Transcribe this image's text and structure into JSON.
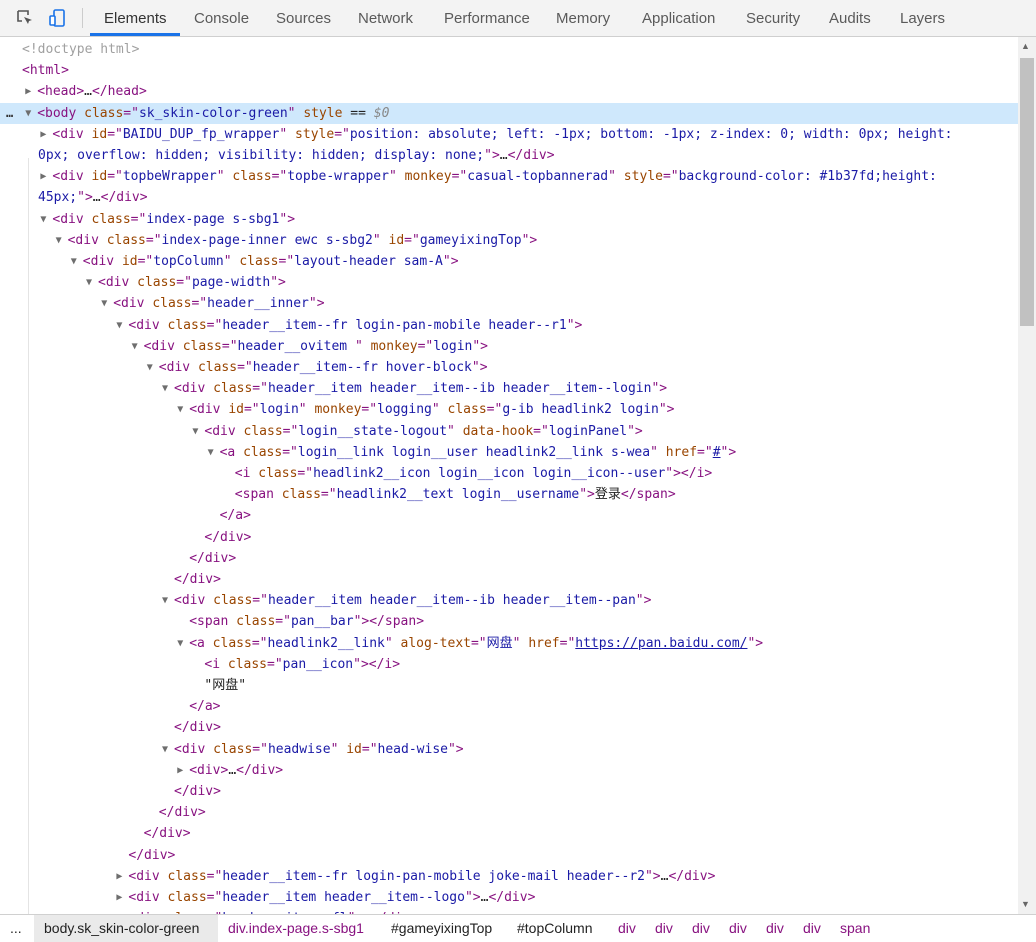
{
  "tabs": [
    {
      "label": "Elements",
      "active": true
    },
    {
      "label": "Console"
    },
    {
      "label": "Sources"
    },
    {
      "label": "Network"
    },
    {
      "label": "Performance"
    },
    {
      "label": "Memory"
    },
    {
      "label": "Application"
    },
    {
      "label": "Security"
    },
    {
      "label": "Audits"
    },
    {
      "label": "Layers"
    }
  ],
  "dom_lines": [
    {
      "indent": 0,
      "segs": [
        [
          "c",
          "<!doctype html>"
        ]
      ]
    },
    {
      "indent": 0,
      "segs": [
        [
          "t",
          "<html>"
        ]
      ]
    },
    {
      "indent": 1,
      "tri": "r",
      "segs": [
        [
          "t",
          "<head>"
        ],
        [
          "x",
          "…"
        ],
        [
          "t",
          "</head>"
        ]
      ]
    },
    {
      "indent": 1,
      "tri": "d",
      "sel": true,
      "segs": [
        [
          "t",
          "<body "
        ],
        [
          "a",
          "class"
        ],
        [
          "t",
          "=\""
        ],
        [
          "v",
          "sk_skin-color-green"
        ],
        [
          "t",
          "\" "
        ],
        [
          "a",
          "style"
        ],
        [
          "x",
          " == "
        ],
        [
          "g",
          "$0"
        ]
      ]
    },
    {
      "indent": 2,
      "tri": "r",
      "segs": [
        [
          "t",
          "<div "
        ],
        [
          "a",
          "id"
        ],
        [
          "t",
          "=\""
        ],
        [
          "v",
          "BAIDU_DUP_fp_wrapper"
        ],
        [
          "t",
          "\" "
        ],
        [
          "a",
          "style"
        ],
        [
          "t",
          "=\""
        ],
        [
          "v",
          "position: absolute; left: -1px; bottom: -1px; z-index: 0; width: 0px; height:"
        ]
      ]
    },
    {
      "indent": 2,
      "cont": true,
      "segs": [
        [
          "v",
          "0px; overflow: hidden; visibility: hidden; display: none;"
        ],
        [
          "t",
          "\">"
        ],
        [
          "x",
          "…"
        ],
        [
          "t",
          "</div>"
        ]
      ]
    },
    {
      "indent": 2,
      "tri": "r",
      "segs": [
        [
          "t",
          "<div "
        ],
        [
          "a",
          "id"
        ],
        [
          "t",
          "=\""
        ],
        [
          "v",
          "topbeWrapper"
        ],
        [
          "t",
          "\" "
        ],
        [
          "a",
          "class"
        ],
        [
          "t",
          "=\""
        ],
        [
          "v",
          "topbe-wrapper"
        ],
        [
          "t",
          "\" "
        ],
        [
          "a",
          "monkey"
        ],
        [
          "t",
          "=\""
        ],
        [
          "v",
          "casual-topbannerad"
        ],
        [
          "t",
          "\" "
        ],
        [
          "a",
          "style"
        ],
        [
          "t",
          "=\""
        ],
        [
          "v",
          "background-color: #1b37fd;height:"
        ]
      ]
    },
    {
      "indent": 2,
      "cont": true,
      "segs": [
        [
          "v",
          "45px;"
        ],
        [
          "t",
          "\">"
        ],
        [
          "x",
          "…"
        ],
        [
          "t",
          "</div>"
        ]
      ]
    },
    {
      "indent": 2,
      "tri": "d",
      "segs": [
        [
          "t",
          "<div "
        ],
        [
          "a",
          "class"
        ],
        [
          "t",
          "=\""
        ],
        [
          "v",
          "index-page s-sbg1"
        ],
        [
          "t",
          "\">"
        ]
      ]
    },
    {
      "indent": 3,
      "tri": "d",
      "segs": [
        [
          "t",
          "<div "
        ],
        [
          "a",
          "class"
        ],
        [
          "t",
          "=\""
        ],
        [
          "v",
          "index-page-inner ewc s-sbg2"
        ],
        [
          "t",
          "\" "
        ],
        [
          "a",
          "id"
        ],
        [
          "t",
          "=\""
        ],
        [
          "v",
          "gameyixingTop"
        ],
        [
          "t",
          "\">"
        ]
      ]
    },
    {
      "indent": 4,
      "tri": "d",
      "segs": [
        [
          "t",
          "<div "
        ],
        [
          "a",
          "id"
        ],
        [
          "t",
          "=\""
        ],
        [
          "v",
          "topColumn"
        ],
        [
          "t",
          "\" "
        ],
        [
          "a",
          "class"
        ],
        [
          "t",
          "=\""
        ],
        [
          "v",
          "layout-header sam-A"
        ],
        [
          "t",
          "\">"
        ]
      ]
    },
    {
      "indent": 5,
      "tri": "d",
      "segs": [
        [
          "t",
          "<div "
        ],
        [
          "a",
          "class"
        ],
        [
          "t",
          "=\""
        ],
        [
          "v",
          "page-width"
        ],
        [
          "t",
          "\">"
        ]
      ]
    },
    {
      "indent": 6,
      "tri": "d",
      "segs": [
        [
          "t",
          "<div "
        ],
        [
          "a",
          "class"
        ],
        [
          "t",
          "=\""
        ],
        [
          "v",
          "header__inner"
        ],
        [
          "t",
          "\">"
        ]
      ]
    },
    {
      "indent": 7,
      "tri": "d",
      "segs": [
        [
          "t",
          "<div "
        ],
        [
          "a",
          "class"
        ],
        [
          "t",
          "=\""
        ],
        [
          "v",
          "header__item--fr login-pan-mobile header--r1"
        ],
        [
          "t",
          "\">"
        ]
      ]
    },
    {
      "indent": 8,
      "tri": "d",
      "segs": [
        [
          "t",
          "<div "
        ],
        [
          "a",
          "class"
        ],
        [
          "t",
          "=\""
        ],
        [
          "v",
          "header__ovitem "
        ],
        [
          "t",
          "\" "
        ],
        [
          "a",
          "monkey"
        ],
        [
          "t",
          "=\""
        ],
        [
          "v",
          "login"
        ],
        [
          "t",
          "\">"
        ]
      ]
    },
    {
      "indent": 9,
      "tri": "d",
      "segs": [
        [
          "t",
          "<div "
        ],
        [
          "a",
          "class"
        ],
        [
          "t",
          "=\""
        ],
        [
          "v",
          "header__item--fr hover-block"
        ],
        [
          "t",
          "\">"
        ]
      ]
    },
    {
      "indent": 10,
      "tri": "d",
      "segs": [
        [
          "t",
          "<div "
        ],
        [
          "a",
          "class"
        ],
        [
          "t",
          "=\""
        ],
        [
          "v",
          "header__item header__item--ib header__item--login"
        ],
        [
          "t",
          "\">"
        ]
      ]
    },
    {
      "indent": 11,
      "tri": "d",
      "segs": [
        [
          "t",
          "<div "
        ],
        [
          "a",
          "id"
        ],
        [
          "t",
          "=\""
        ],
        [
          "v",
          "login"
        ],
        [
          "t",
          "\" "
        ],
        [
          "a",
          "monkey"
        ],
        [
          "t",
          "=\""
        ],
        [
          "v",
          "logging"
        ],
        [
          "t",
          "\" "
        ],
        [
          "a",
          "class"
        ],
        [
          "t",
          "=\""
        ],
        [
          "v",
          "g-ib headlink2 login"
        ],
        [
          "t",
          "\">"
        ]
      ]
    },
    {
      "indent": 12,
      "tri": "d",
      "segs": [
        [
          "t",
          "<div "
        ],
        [
          "a",
          "class"
        ],
        [
          "t",
          "=\""
        ],
        [
          "v",
          "login__state-logout"
        ],
        [
          "t",
          "\" "
        ],
        [
          "a",
          "data-hook"
        ],
        [
          "t",
          "=\""
        ],
        [
          "v",
          "loginPanel"
        ],
        [
          "t",
          "\">"
        ]
      ]
    },
    {
      "indent": 13,
      "tri": "d",
      "segs": [
        [
          "t",
          "<a "
        ],
        [
          "a",
          "class"
        ],
        [
          "t",
          "=\""
        ],
        [
          "v",
          "login__link login__user headlink2__link s-wea"
        ],
        [
          "t",
          "\" "
        ],
        [
          "a",
          "href"
        ],
        [
          "t",
          "=\""
        ],
        [
          "lk",
          "#"
        ],
        [
          "t",
          "\">"
        ]
      ]
    },
    {
      "indent": 14,
      "segs": [
        [
          "t",
          "<i "
        ],
        [
          "a",
          "class"
        ],
        [
          "t",
          "=\""
        ],
        [
          "v",
          "headlink2__icon login__icon login__icon--user"
        ],
        [
          "t",
          "\"></i>"
        ]
      ]
    },
    {
      "indent": 14,
      "segs": [
        [
          "t",
          "<span "
        ],
        [
          "a",
          "class"
        ],
        [
          "t",
          "=\""
        ],
        [
          "v",
          "headlink2__text login__username"
        ],
        [
          "t",
          "\">"
        ],
        [
          "x",
          "登录"
        ],
        [
          "t",
          "</span>"
        ]
      ]
    },
    {
      "indent": 13,
      "segs": [
        [
          "t",
          "</a>"
        ]
      ]
    },
    {
      "indent": 12,
      "segs": [
        [
          "t",
          "</div>"
        ]
      ]
    },
    {
      "indent": 11,
      "segs": [
        [
          "t",
          "</div>"
        ]
      ]
    },
    {
      "indent": 10,
      "segs": [
        [
          "t",
          "</div>"
        ]
      ]
    },
    {
      "indent": 10,
      "tri": "d",
      "segs": [
        [
          "t",
          "<div "
        ],
        [
          "a",
          "class"
        ],
        [
          "t",
          "=\""
        ],
        [
          "v",
          "header__item header__item--ib header__item--pan"
        ],
        [
          "t",
          "\">"
        ]
      ]
    },
    {
      "indent": 11,
      "segs": [
        [
          "t",
          "<span "
        ],
        [
          "a",
          "class"
        ],
        [
          "t",
          "=\""
        ],
        [
          "v",
          "pan__bar"
        ],
        [
          "t",
          "\"></span>"
        ]
      ]
    },
    {
      "indent": 11,
      "tri": "d",
      "segs": [
        [
          "t",
          "<a "
        ],
        [
          "a",
          "class"
        ],
        [
          "t",
          "=\""
        ],
        [
          "v",
          "headlink2__link"
        ],
        [
          "t",
          "\" "
        ],
        [
          "a",
          "alog-text"
        ],
        [
          "t",
          "=\""
        ],
        [
          "v",
          "网盘"
        ],
        [
          "t",
          "\" "
        ],
        [
          "a",
          "href"
        ],
        [
          "t",
          "=\""
        ],
        [
          "lk",
          "https://pan.baidu.com/"
        ],
        [
          "t",
          "\">"
        ]
      ]
    },
    {
      "indent": 12,
      "segs": [
        [
          "t",
          "<i "
        ],
        [
          "a",
          "class"
        ],
        [
          "t",
          "=\""
        ],
        [
          "v",
          "pan__icon"
        ],
        [
          "t",
          "\"></i>"
        ]
      ]
    },
    {
      "indent": 12,
      "segs": [
        [
          "x",
          "\"网盘\""
        ]
      ]
    },
    {
      "indent": 11,
      "segs": [
        [
          "t",
          "</a>"
        ]
      ]
    },
    {
      "indent": 10,
      "segs": [
        [
          "t",
          "</div>"
        ]
      ]
    },
    {
      "indent": 10,
      "tri": "d",
      "segs": [
        [
          "t",
          "<div "
        ],
        [
          "a",
          "class"
        ],
        [
          "t",
          "=\""
        ],
        [
          "v",
          "headwise"
        ],
        [
          "t",
          "\" "
        ],
        [
          "a",
          "id"
        ],
        [
          "t",
          "=\""
        ],
        [
          "v",
          "head-wise"
        ],
        [
          "t",
          "\">"
        ]
      ]
    },
    {
      "indent": 11,
      "tri": "r",
      "segs": [
        [
          "t",
          "<div>"
        ],
        [
          "x",
          "…"
        ],
        [
          "t",
          "</div>"
        ]
      ]
    },
    {
      "indent": 10,
      "segs": [
        [
          "t",
          "</div>"
        ]
      ]
    },
    {
      "indent": 9,
      "segs": [
        [
          "t",
          "</div>"
        ]
      ]
    },
    {
      "indent": 8,
      "segs": [
        [
          "t",
          "</div>"
        ]
      ]
    },
    {
      "indent": 7,
      "segs": [
        [
          "t",
          "</div>"
        ]
      ]
    },
    {
      "indent": 7,
      "tri": "r",
      "segs": [
        [
          "t",
          "<div "
        ],
        [
          "a",
          "class"
        ],
        [
          "t",
          "=\""
        ],
        [
          "v",
          "header__item--fr login-pan-mobile joke-mail header--r2"
        ],
        [
          "t",
          "\">"
        ],
        [
          "x",
          "…"
        ],
        [
          "t",
          "</div>"
        ]
      ]
    },
    {
      "indent": 7,
      "tri": "r",
      "segs": [
        [
          "t",
          "<div "
        ],
        [
          "a",
          "class"
        ],
        [
          "t",
          "=\""
        ],
        [
          "v",
          "header__item header__item--logo"
        ],
        [
          "t",
          "\">"
        ],
        [
          "x",
          "…"
        ],
        [
          "t",
          "</div>"
        ]
      ]
    },
    {
      "indent": 7,
      "tri": "r",
      "segs": [
        [
          "t",
          "<div "
        ],
        [
          "a",
          "class"
        ],
        [
          "t",
          "=\""
        ],
        [
          "v",
          "header__item--fl"
        ],
        [
          "t",
          "\">"
        ],
        [
          "x",
          "…"
        ],
        [
          "t",
          "</div>"
        ]
      ]
    }
  ],
  "breadcrumbs": [
    {
      "label": "..."
    },
    {
      "label": "body.sk_skin-color-green",
      "active": true
    },
    {
      "label": "div.index-page.s-sbg1"
    },
    {
      "label": "#gameyixingTop",
      "plain": true
    },
    {
      "label": "#topColumn",
      "plain": true
    },
    {
      "label": "div"
    },
    {
      "label": "div"
    },
    {
      "label": "div"
    },
    {
      "label": "div"
    },
    {
      "label": "div"
    },
    {
      "label": "div"
    },
    {
      "label": "span"
    }
  ]
}
